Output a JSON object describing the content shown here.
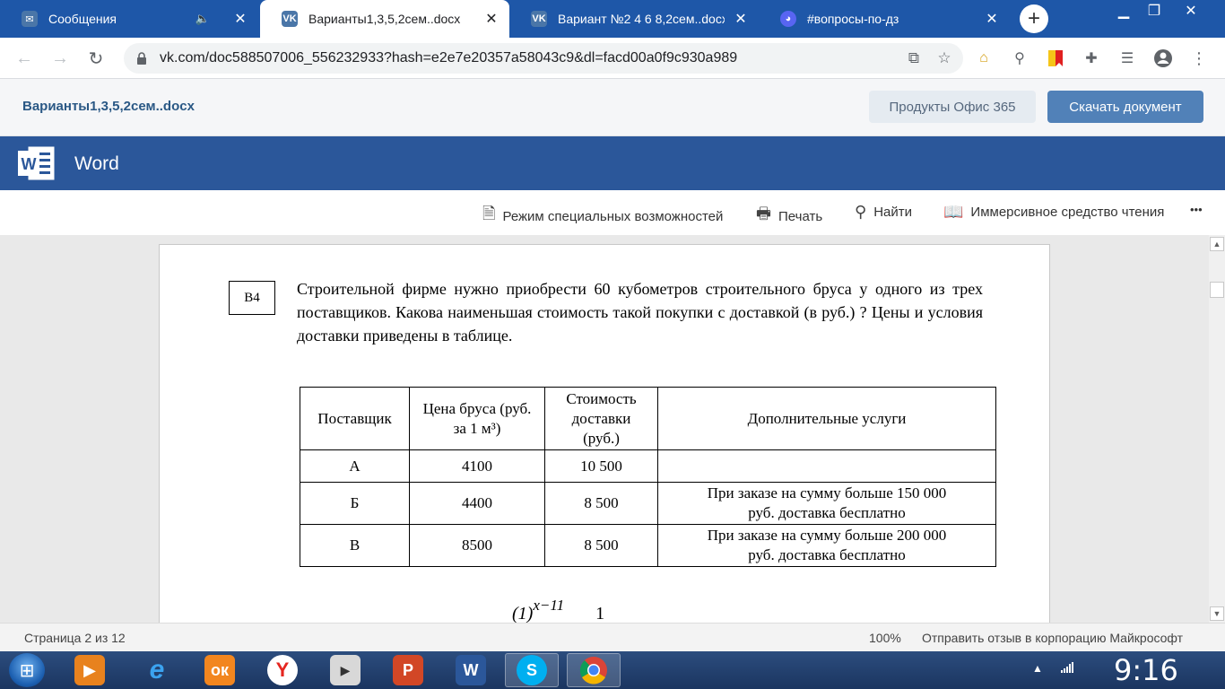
{
  "browser": {
    "tabs": [
      {
        "label": "Сообщения",
        "active": false
      },
      {
        "label": "Варианты1,3,5,2сем..docx",
        "active": true
      },
      {
        "label": "Вариант №2 4 6 8,2сем..docx",
        "active": false
      },
      {
        "label": "#вопросы-по-дз",
        "active": false
      }
    ],
    "url": "vk.com/doc588507006_556232933?hash=e2e7e20357a58043c9&dl=facd00a0f9c930a989",
    "new_tab_symbol": "+"
  },
  "vk": {
    "doc_name": "Варианты1,3,5,2сем..docx",
    "office_button": "Продукты Офис 365",
    "download_button": "Скачать документ"
  },
  "word": {
    "app_title": "Word",
    "commands": {
      "accessibility": "Режим специальных возможностей",
      "print": "Печать",
      "find": "Найти",
      "immersive": "Иммерсивное средство чтения",
      "more": "•••"
    }
  },
  "document": {
    "badge": "В4",
    "problem_text": "Строительной фирме нужно приобрести 60 кубометров строительного бруса у одного из трех поставщиков. Какова наименьшая стоимость такой покупки с доставкой (в руб.) ? Цены и условия доставки приведены в таблице.",
    "table": {
      "headers": [
        "Поставщик",
        "Цена бруса (руб. за 1 м³)",
        "Стоимость доставки (руб.)",
        "Дополнительные услуги"
      ],
      "rows": [
        [
          "А",
          "4100",
          "10 500",
          ""
        ],
        [
          "Б",
          "4400",
          "8 500",
          "При заказе на сумму больше 150 000 руб. доставка бесплатно"
        ],
        [
          "В",
          "8500",
          "8 500",
          "При заказе на сумму больше 200 000 руб. доставка бесплатно"
        ]
      ]
    },
    "formula_base": "(1)",
    "formula_exp": "x−11",
    "formula_tail": "1"
  },
  "status": {
    "page": "Страница 2 из 12",
    "zoom": "100%",
    "feedback": "Отправить отзыв в корпорацию Майкрософт"
  },
  "taskbar": {
    "clock": "9:16"
  }
}
